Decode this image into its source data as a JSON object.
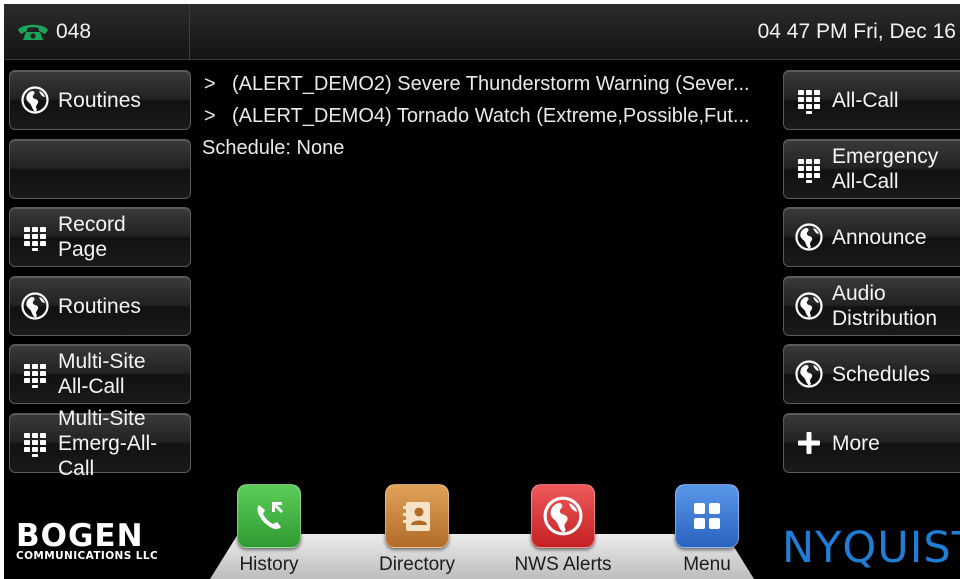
{
  "status_bar": {
    "extension": "048",
    "clock": "04 47 PM Fri, Dec 16"
  },
  "left_buttons": [
    {
      "label": "Routines",
      "icon": "globe-icon"
    },
    {
      "label": "",
      "icon": ""
    },
    {
      "label": "Record\nPage",
      "icon": "keypad-icon"
    },
    {
      "label": "Routines",
      "icon": "globe-icon"
    },
    {
      "label": "Multi-Site\nAll-Call",
      "icon": "keypad-icon"
    },
    {
      "label": "Multi-Site\nEmerg-All-Call",
      "icon": "keypad-icon"
    }
  ],
  "right_buttons": [
    {
      "label": "All-Call",
      "icon": "keypad-icon"
    },
    {
      "label": "Emergency\nAll-Call",
      "icon": "keypad-icon"
    },
    {
      "label": "Announce",
      "icon": "globe-icon"
    },
    {
      "label": "Audio\nDistribution",
      "icon": "globe-icon"
    },
    {
      "label": "Schedules",
      "icon": "globe-icon"
    },
    {
      "label": "More",
      "icon": "plus-icon"
    }
  ],
  "messages": {
    "arrow": ">",
    "alerts": [
      "(ALERT_DEMO2) Severe Thunderstorm Warning (Sever...",
      "(ALERT_DEMO4) Tornado Watch (Extreme,Possible,Fut..."
    ],
    "schedule": "Schedule: None"
  },
  "dock": [
    {
      "label": "History",
      "icon": "phone-history-icon",
      "color": "#3cae3c"
    },
    {
      "label": "Directory",
      "icon": "address-book-icon",
      "color": "#c9853a"
    },
    {
      "label": "NWS Alerts",
      "icon": "globe-icon",
      "color": "#e0393b"
    },
    {
      "label": "Menu",
      "icon": "grid-menu-icon",
      "color": "#3878d4"
    }
  ],
  "logos": {
    "bogen": "BOGEN",
    "bogen_sub": "COMMUNICATIONS LLC",
    "nyquist": "NYQUIST"
  },
  "colors": {
    "phone_icon": "#1aa35a",
    "nyquist_blue": "#1f7fd6"
  }
}
